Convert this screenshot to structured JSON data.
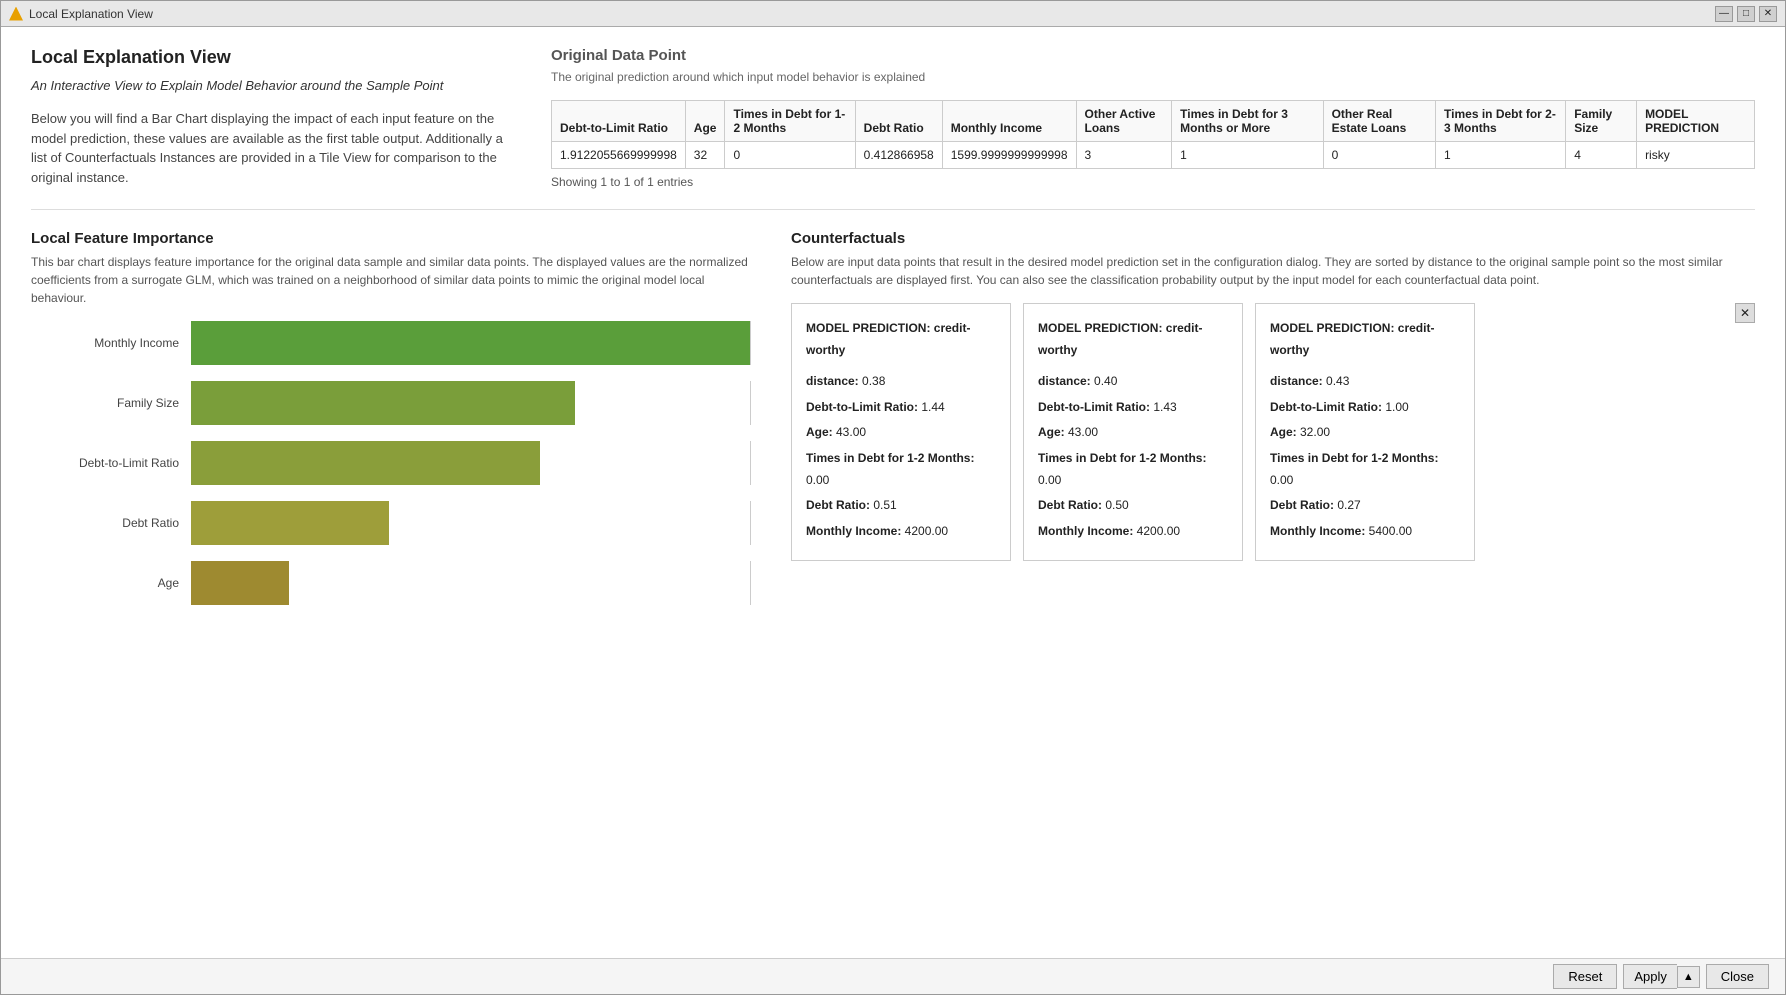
{
  "window": {
    "title": "Local Explanation View",
    "icon": "triangle-icon"
  },
  "titlebar_controls": {
    "minimize": "—",
    "maximize": "□",
    "close": "✕"
  },
  "left_panel": {
    "heading": "Local Explanation View",
    "subtitle": "An Interactive View to Explain Model Behavior around the Sample Point",
    "description": "Below you will find a Bar Chart displaying the impact of each input feature on the model prediction, these values are available as the first table output. Additionally a list of Counterfactuals Instances are provided in a Tile View for comparison to the original instance."
  },
  "original_data": {
    "title": "Original Data Point",
    "description": "The original prediction around which input model behavior is explained",
    "table": {
      "columns": [
        "Debt-to-Limit Ratio",
        "Age",
        "Times in Debt for 1-2 Months",
        "Debt Ratio",
        "Monthly Income",
        "Other Active Loans",
        "Times in Debt for 3 Months or More",
        "Other Real Estate Loans",
        "Times in Debt for 2-3 Months",
        "Family Size",
        "MODEL PREDICTION"
      ],
      "rows": [
        {
          "debt_limit": "1.9122055669999998",
          "age": "32",
          "times_1_2": "0",
          "debt_ratio": "0.412866958",
          "monthly_income": "1599.9999999999998",
          "other_active": "3",
          "times_3_more": "1",
          "other_real_estate": "0",
          "times_2_3": "1",
          "family_size": "4",
          "prediction": "risky"
        }
      ],
      "showing": "Showing 1 to 1 of 1 entries"
    }
  },
  "local_feature": {
    "title": "Local Feature Importance",
    "description": "This bar chart displays feature importance for the original data sample and similar data points. The displayed values are the normalized coefficients from a surrogate GLM, which was trained on a neighborhood of similar data points to mimic the original model local behaviour.",
    "bars": [
      {
        "label": "Monthly Income",
        "value": 240,
        "color": "#5a9e3a"
      },
      {
        "label": "Family Size",
        "value": 165,
        "color": "#7a9e3a"
      },
      {
        "label": "Debt-to-Limit Ratio",
        "value": 150,
        "color": "#8a9e3a"
      },
      {
        "label": "Debt Ratio",
        "value": 85,
        "color": "#9e9e3a"
      },
      {
        "label": "Age",
        "value": 42,
        "color": "#9e8a30"
      }
    ]
  },
  "counterfactuals": {
    "title": "Counterfactuals",
    "description": "Below are input data points that result in the desired model prediction set in the configuration dialog. They are sorted by distance to the original sample point so the most similar counterfactuals are displayed first. You can also see the classification probability output by the input model for each counterfactual data point.",
    "cards": [
      {
        "prediction_label": "MODEL PREDICTION:",
        "prediction_value": "credit-worthy",
        "distance_label": "distance:",
        "distance_value": "0.38",
        "fields": [
          {
            "label": "Debt-to-Limit Ratio:",
            "value": "1.44"
          },
          {
            "label": "Age:",
            "value": "43.00"
          },
          {
            "label": "Times in Debt for 1-2 Months:",
            "value": "0.00"
          },
          {
            "label": "Debt Ratio:",
            "value": "0.51"
          },
          {
            "label": "Monthly Income:",
            "value": "4200.00"
          }
        ]
      },
      {
        "prediction_label": "MODEL PREDICTION:",
        "prediction_value": "credit-worthy",
        "distance_label": "distance:",
        "distance_value": "0.40",
        "fields": [
          {
            "label": "Debt-to-Limit Ratio:",
            "value": "1.43"
          },
          {
            "label": "Age:",
            "value": "43.00"
          },
          {
            "label": "Times in Debt for 1-2 Months:",
            "value": "0.00"
          },
          {
            "label": "Debt Ratio:",
            "value": "0.50"
          },
          {
            "label": "Monthly Income:",
            "value": "4200.00"
          }
        ]
      },
      {
        "prediction_label": "MODEL PREDICTION:",
        "prediction_value": "credit-worthy",
        "distance_label": "distance:",
        "distance_value": "0.43",
        "fields": [
          {
            "label": "Debt-to-Limit Ratio:",
            "value": "1.00"
          },
          {
            "label": "Age:",
            "value": "32.00"
          },
          {
            "label": "Times in Debt for 1-2 Months:",
            "value": "0.00"
          },
          {
            "label": "Debt Ratio:",
            "value": "0.27"
          },
          {
            "label": "Monthly Income:",
            "value": "5400.00"
          }
        ]
      }
    ]
  },
  "bottom_bar": {
    "reset_label": "Reset",
    "apply_label": "Apply",
    "close_label": "Close"
  }
}
